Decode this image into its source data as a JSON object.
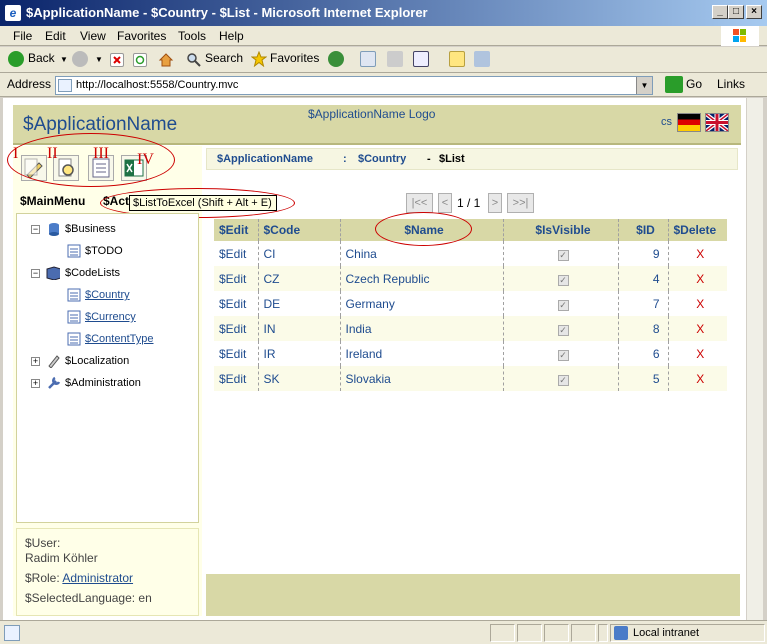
{
  "window": {
    "title": "$ApplicationName - $Country - $List - Microsoft Internet Explorer"
  },
  "menu": [
    "File",
    "Edit",
    "View",
    "Favorites",
    "Tools",
    "Help"
  ],
  "toolbar": {
    "back": "Back",
    "search": "Search",
    "favorites": "Favorites"
  },
  "address": {
    "label": "Address",
    "url": "http://localhost:5558/Country.mvc",
    "go": "Go",
    "links": "Links"
  },
  "header": {
    "app_name": "$ApplicationName",
    "logo": "$ApplicationName Logo",
    "lang": "cs"
  },
  "annotations": {
    "i": "I",
    "ii": "II",
    "iii": "III",
    "iv": "IV"
  },
  "breadcrumb": {
    "part1": "$ApplicationName",
    "sep1": ":",
    "part2": "$Country",
    "sep2": "-",
    "part3": "$List"
  },
  "tabs": {
    "main_menu": "$MainMenu",
    "actions": "$Act"
  },
  "tooltip": "$ListToExcel (Shift + Alt + E)",
  "tree": {
    "business": "$Business",
    "todo": "$TODO",
    "codelists": "$CodeLists",
    "country": "$Country",
    "currency": "$Currency",
    "contenttype": "$ContentType",
    "localization": "$Localization",
    "administration": "$Administration"
  },
  "user": {
    "user_label": "$User:",
    "user_name": "Radim Köhler",
    "role_label": "$Role:",
    "role_value": "Administrator",
    "lang_line": "$SelectedLanguage: en"
  },
  "pager": {
    "first": "|<<",
    "prev": "<",
    "text": "1 / 1",
    "next": ">",
    "last": ">>|"
  },
  "grid": {
    "headers": [
      "$Edit",
      "$Code",
      "$Name",
      "$IsVisible",
      "$ID",
      "$Delete"
    ],
    "rows": [
      {
        "edit": "$Edit",
        "code": "CI",
        "name": "China",
        "visible": true,
        "id": "9",
        "del": "X"
      },
      {
        "edit": "$Edit",
        "code": "CZ",
        "name": "Czech Republic",
        "visible": true,
        "id": "4",
        "del": "X"
      },
      {
        "edit": "$Edit",
        "code": "DE",
        "name": "Germany",
        "visible": true,
        "id": "7",
        "del": "X"
      },
      {
        "edit": "$Edit",
        "code": "IN",
        "name": "India",
        "visible": true,
        "id": "8",
        "del": "X"
      },
      {
        "edit": "$Edit",
        "code": "IR",
        "name": "Ireland",
        "visible": true,
        "id": "6",
        "del": "X"
      },
      {
        "edit": "$Edit",
        "code": "SK",
        "name": "Slovakia",
        "visible": true,
        "id": "5",
        "del": "X"
      }
    ]
  },
  "status": {
    "zone": "Local intranet"
  },
  "colors": {
    "header_bg": "#d8d8a6",
    "link": "#1f4c8f",
    "annotation": "#cc0000"
  }
}
